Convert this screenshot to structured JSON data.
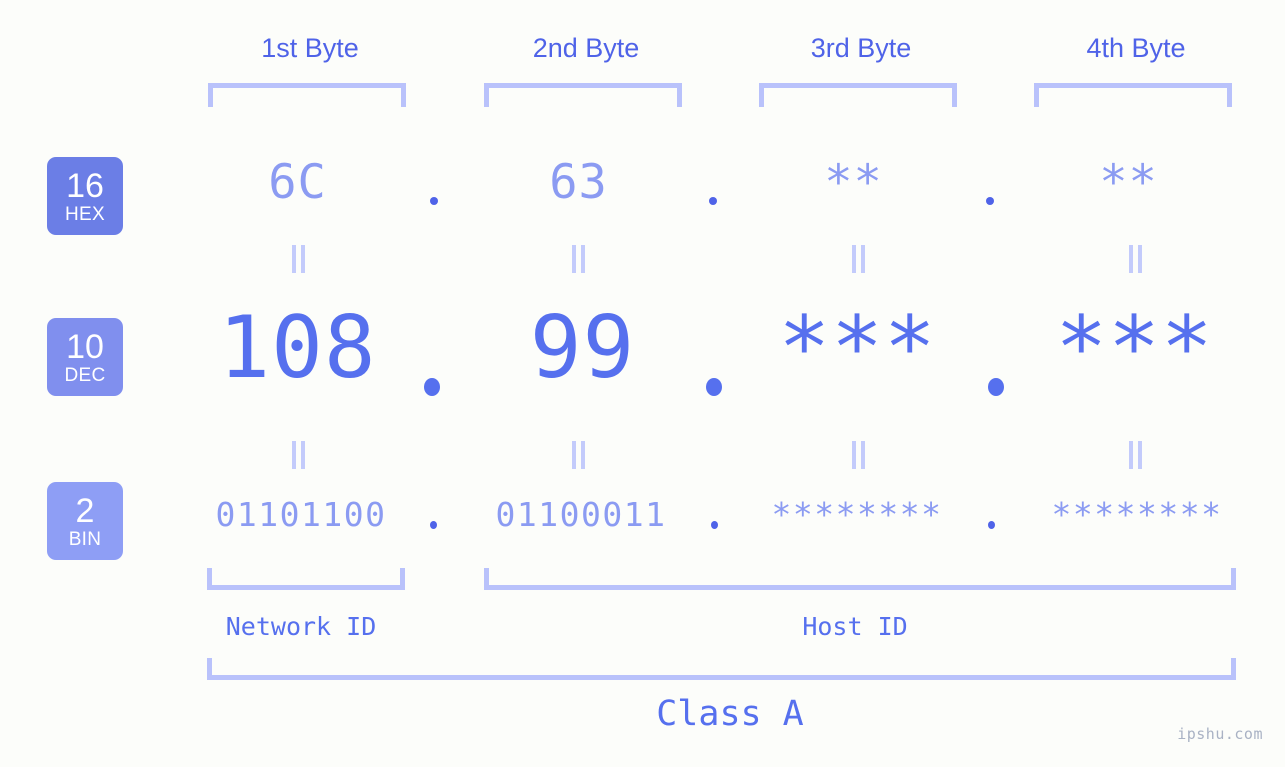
{
  "watermark": "ipshu.com",
  "bases": [
    {
      "id": "hex",
      "number": "16",
      "system": "HEX",
      "color": "#6b7ee6"
    },
    {
      "id": "dec",
      "number": "10",
      "system": "DEC",
      "color": "#808fee"
    },
    {
      "id": "bin",
      "number": "2",
      "system": "BIN",
      "color": "#8e9ef5"
    }
  ],
  "byte_headers": [
    {
      "label": "1st Byte"
    },
    {
      "label": "2nd Byte"
    },
    {
      "label": "3rd Byte"
    },
    {
      "label": "4th Byte"
    }
  ],
  "rows": {
    "hex": {
      "values": [
        "6C",
        "63",
        "**",
        "**"
      ]
    },
    "dec": {
      "values": [
        "108",
        "99",
        "***",
        "***"
      ]
    },
    "bin": {
      "values": [
        "01101100",
        "01100011",
        "********",
        "********"
      ]
    }
  },
  "separator": ".",
  "equality_symbol": "=",
  "sections": {
    "network_id": "Network ID",
    "host_id": "Host ID",
    "class": "Class A"
  },
  "colors": {
    "background": "#fcfdfa",
    "accent_strong": "#4f63e8",
    "accent_mid": "#5670ee",
    "accent_light": "#8b9bf2",
    "bracket": "#b9c2fb",
    "equality": "#c3cbfb",
    "watermark": "#a9b2c4"
  }
}
